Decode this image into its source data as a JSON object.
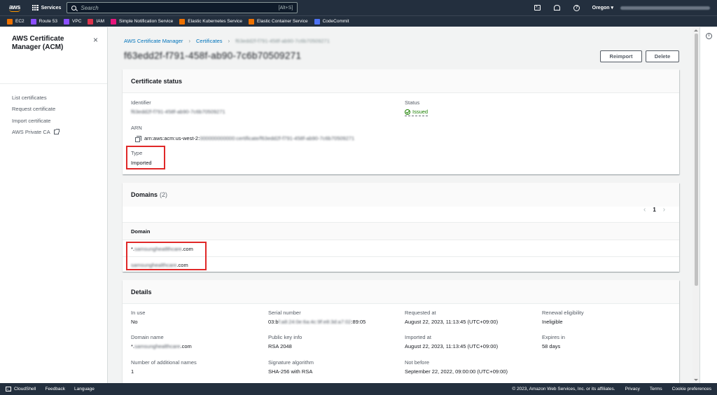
{
  "topnav": {
    "logo": "aws",
    "services_label": "Services",
    "search_placeholder": "Search",
    "search_shortcut": "[Alt+S]",
    "region": "Oregon ▾"
  },
  "favorites": [
    {
      "label": "EC2",
      "color": "#ed7100"
    },
    {
      "label": "Route 53",
      "color": "#8c4fff"
    },
    {
      "label": "VPC",
      "color": "#8c4fff"
    },
    {
      "label": "IAM",
      "color": "#dd344c"
    },
    {
      "label": "Simple Notification Service",
      "color": "#e7157b"
    },
    {
      "label": "Elastic Kubernetes Service",
      "color": "#ed7100"
    },
    {
      "label": "Elastic Container Service",
      "color": "#ed7100"
    },
    {
      "label": "CodeCommit",
      "color": "#4d72f3"
    }
  ],
  "sidebar": {
    "title": "AWS Certificate Manager (ACM)",
    "close": "×",
    "links": [
      "List certificates",
      "Request certificate",
      "Import certificate",
      "AWS Private CA"
    ]
  },
  "breadcrumb": {
    "root": "AWS Certificate Manager",
    "level2": "Certificates",
    "current": "f63edd2f-f791-458f-ab90-7c6b70509271"
  },
  "page": {
    "title": "f63edd2f-f791-458f-ab90-7c6b70509271",
    "reimport_label": "Reimport",
    "delete_label": "Delete"
  },
  "status_card": {
    "title": "Certificate status",
    "identifier_label": "Identifier",
    "identifier_value": "f63edd2f-f791-458f-ab90-7c6b70509271",
    "status_label": "Status",
    "status_value": "Issued",
    "arn_label": "ARN",
    "arn_prefix": "arn:aws:acm:us-west-2:",
    "arn_rest": "000000000000:certificate/f63edd2f-f791-458f-ab90-7c6b70509271",
    "type_label": "Type",
    "type_value": "Imported"
  },
  "domains_card": {
    "title": "Domains",
    "count": "(2)",
    "page": "1",
    "column": "Domain",
    "rows": [
      {
        "prefix": "*.",
        "blur": "samsungheatlthcare",
        "suffix": ".com"
      },
      {
        "prefix": "",
        "blur": "samsunghealthcare",
        "suffix": ".com"
      }
    ]
  },
  "details_card": {
    "title": "Details",
    "in_use_label": "In use",
    "in_use_value": "No",
    "serial_label": "Serial number",
    "serial_prefix": "03:b",
    "serial_blur": "f:a8:24:0e:6a:4c:9f:e8:3d:a7:02",
    "serial_suffix": ":89:05",
    "requested_label": "Requested at",
    "requested_value": "August 22, 2023, 11:13:45 (UTC+09:00)",
    "renewal_label": "Renewal eligibility",
    "renewal_value": "Ineligible",
    "domain_name_label": "Domain name",
    "domain_name_prefix": "*.",
    "domain_name_blur": "samsunghealthcare",
    "domain_name_suffix": ".com",
    "public_key_label": "Public key info",
    "public_key_value": "RSA 2048",
    "imported_label": "Imported at",
    "imported_value": "August 22, 2023, 11:13:45 (UTC+09:00)",
    "expires_label": "Expires in",
    "expires_value": "58 days",
    "additional_names_label": "Number of additional names",
    "additional_names_value": "1",
    "sig_label": "Signature algorithm",
    "sig_value": "SHA-256 with RSA",
    "not_before_label": "Not before",
    "not_before_value": "September 22, 2022, 09:00:00 (UTC+09:00)"
  },
  "footer": {
    "cloudshell": "CloudShell",
    "feedback": "Feedback",
    "language": "Language",
    "copyright": "© 2023, Amazon Web Services, Inc. or its affiliates.",
    "privacy": "Privacy",
    "terms": "Terms",
    "cookies": "Cookie preferences"
  }
}
